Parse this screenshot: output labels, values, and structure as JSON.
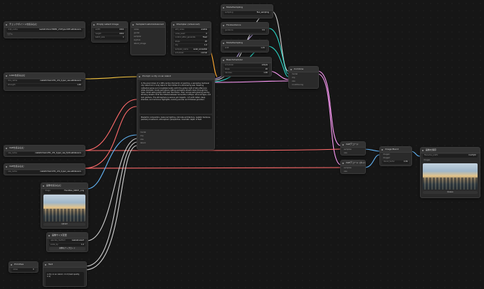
{
  "nodes": {
    "checkpoint_loader": {
      "title": "チェックポイントを読み込む",
      "rows": [
        {
          "label": "ckpt_name",
          "value": "realisticVisionV60B1_v51HyperVAE.safetensors"
        }
      ],
      "button": "モデル"
    },
    "empty_latent": {
      "title": "Empty Latent Image",
      "rows": [
        {
          "label": "width",
          "value": "1024"
        },
        {
          "label": "height",
          "value": "1024"
        },
        {
          "label": "batch_size",
          "value": "1"
        }
      ]
    },
    "sampler_custom": {
      "title": "SamplerCustomAdvanced",
      "rows": [
        {
          "label": "noise",
          "value": ""
        },
        {
          "label": "guider",
          "value": ""
        },
        {
          "label": "sampler",
          "value": ""
        },
        {
          "label": "sigmas",
          "value": ""
        },
        {
          "label": "latent_image",
          "value": ""
        }
      ]
    },
    "ksampler": {
      "title": "KSampler (Advanced)",
      "rows": [
        {
          "label": "add_noise",
          "value": "enable"
        },
        {
          "label": "noise_seed",
          "value": "0"
        },
        {
          "label": "control_after_generate",
          "value": "fixed"
        },
        {
          "label": "steps",
          "value": "20"
        },
        {
          "label": "cfg",
          "value": "1.0"
        },
        {
          "label": "sampler_name",
          "value": "euler_ancestral"
        },
        {
          "label": "scheduler",
          "value": "normal"
        }
      ]
    },
    "model_sampling": {
      "title": "ModelSampling",
      "rows": [
        {
          "label": "sampling",
          "value": "flux_sampling"
        },
        {
          "label": "shift",
          "value": "1.15"
        }
      ]
    },
    "guidance": {
      "title": "FluxGuidance",
      "rows": [
        {
          "label": "guidance",
          "value": "3.5"
        }
      ]
    },
    "scheduler": {
      "title": "BasicScheduler",
      "rows": [
        {
          "label": "scheduler",
          "value": "simple"
        },
        {
          "label": "steps",
          "value": "20"
        },
        {
          "label": "denoise",
          "value": "1.00"
        }
      ]
    },
    "combine": {
      "title": "Combine",
      "rows": [
        {
          "label": "model",
          "value": ""
        },
        {
          "label": "clip",
          "value": ""
        },
        {
          "label": "vae",
          "value": ""
        },
        {
          "label": "conditioning",
          "value": ""
        }
      ]
    },
    "lora_loader": {
      "title": "LoRAを読み込む",
      "rows": [
        {
          "label": "lora_name",
          "value": "realisticVisionV51_v51_hyper_vae.safetensors"
        },
        {
          "label": "strength",
          "value": "1.00"
        }
      ]
    },
    "prompt": {
      "title": "Prompt: a city on an island",
      "text": "In the grand style of a 19th-century Romantic oil painting, a sprawling medieval city rises from a rocky island in the middle of a shimmering sea. Towering cathedral spires and crenellated walls catch the golden light of late afternoon while dramatic clouds part above, letting sunbeams stream down through the haze. Small sailing ships drift near the harbor, their canvas sails glowing warmly. Winding streets climb the hillside between terracotta rooftops, stone bridges, and lush gardens. The atmosphere is serene yet majestic, rich with detail, deep shadows, and luminous highlights, evoking wonder and timeless grandeur.",
      "text2": "Masterful composition, balanced lighting, intricate architecture, realistic textures, painterly brushwork, atmospheric perspective, cinematic depth of field.",
      "outputs": [
        "model",
        "clip",
        "vae",
        "latent"
      ]
    },
    "vae_loader_1": {
      "title": "VAEを読み込む",
      "rows": [
        {
          "label": "vae_name",
          "value": "realisticVisionV51_v51_hyper_vae_fp16.safetensors"
        }
      ]
    },
    "vae_loader_2": {
      "title": "VAEを読み込む",
      "rows": [
        {
          "label": "vae_name",
          "value": "realisticVisionV51_v51_hyper_vae.safetensors"
        }
      ]
    },
    "load_image": {
      "title": "画像を読み込む",
      "rows": [
        {
          "label": "image",
          "value": "Flux1Dev_00007_.png"
        }
      ],
      "button": "upload"
    },
    "resize": {
      "title": "画像サイズ変更",
      "rows": [
        {
          "label": "upscale_method",
          "value": "nearest-exact"
        },
        {
          "label": "scale_by",
          "value": "1.0"
        }
      ],
      "button": "画像をアップロード"
    },
    "primitive": {
      "title": "Primitive",
      "rows": [
        {
          "label": "value",
          "value": "0"
        }
      ]
    },
    "text_node": {
      "title": "Text",
      "text": "a city on an island, 1:1.9 (best quality, 1:4)"
    },
    "vae_decode_1": {
      "title": "VAEデコード",
      "rows": [
        {
          "label": "samples",
          "value": ""
        },
        {
          "label": "vae",
          "value": ""
        }
      ]
    },
    "vae_decode_2": {
      "title": "VAEデコード (タイル)",
      "rows": [
        {
          "label": "samples",
          "value": ""
        },
        {
          "label": "vae",
          "value": ""
        }
      ]
    },
    "image_blend": {
      "title": "Image Blend",
      "rows": [
        {
          "label": "image1",
          "value": ""
        },
        {
          "label": "image2",
          "value": ""
        },
        {
          "label": "blend_factor",
          "value": "0.50"
        }
      ]
    },
    "save_image": {
      "title": "画像を保存",
      "rows": [
        {
          "label": "filename_prefix",
          "value": "ComfyUI"
        },
        {
          "label": "images",
          "value": ""
        }
      ],
      "button": "Queue"
    }
  },
  "colors": {
    "model": "#b39ddb",
    "clip": "#f5c542",
    "vae": "#ff6b6b",
    "latent": "#ff9cf9",
    "conditioning": "#ffa931",
    "image": "#64b5f6",
    "int": "#2ad4c4",
    "misc": "#d0d0d0"
  }
}
